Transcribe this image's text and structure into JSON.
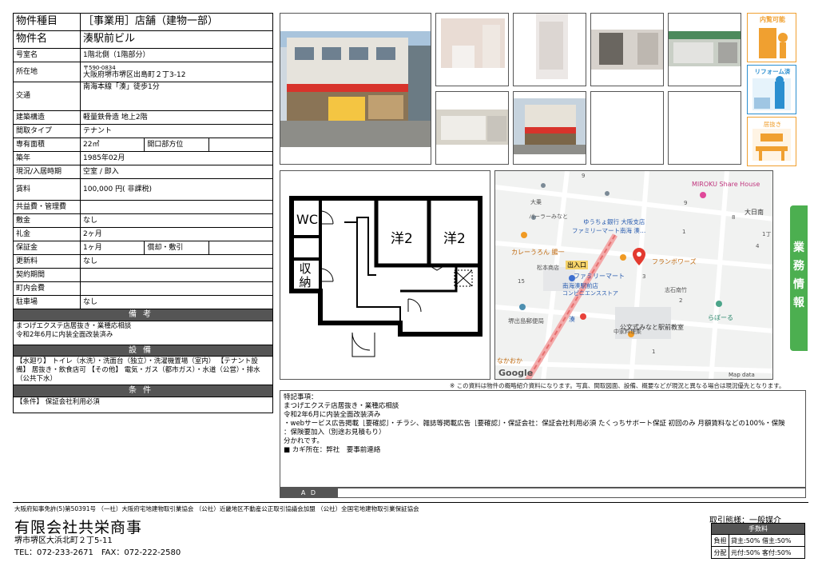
{
  "property": {
    "rows": [
      {
        "key": "物件種目",
        "value": "［事業用］店舗（建物一部）"
      },
      {
        "key": "物件名",
        "value": "湊駅前ビル"
      },
      {
        "key": "号室名",
        "value": "1階北側（1階部分）"
      },
      {
        "key": "所在地",
        "postal": "〒590-0834",
        "value": "大阪府堺市堺区出島町２丁3-12"
      },
      {
        "key": "交通",
        "value": "南海本線「湊」徒歩1分"
      },
      {
        "key": "建築構造",
        "value": "軽量鉄骨造 地上2階"
      },
      {
        "key": "間取タイプ",
        "value": "テナント"
      },
      {
        "key": "専有面積",
        "value": "22㎡",
        "key2": "開口部方位",
        "value2": ""
      },
      {
        "key": "築年",
        "value": "1985年02月"
      },
      {
        "key": "現況/入居時期",
        "value": "空室 / 即入"
      },
      {
        "key": "賃料",
        "value": "100,000 円( 非課税)"
      },
      {
        "key": "共益費・管理費",
        "value": ""
      },
      {
        "key": "敷金",
        "value": "なし"
      },
      {
        "key": "礼金",
        "value": "2ヶ月"
      },
      {
        "key": "保証金",
        "value": "1ヶ月",
        "key2": "償却・敷引",
        "value2": ""
      },
      {
        "key": "更新料",
        "value": "なし"
      },
      {
        "key": "契約期間",
        "value": ""
      },
      {
        "key": "町内会費",
        "value": ""
      },
      {
        "key": "駐車場",
        "value": "なし"
      }
    ],
    "bikou_title": "備考",
    "bikou_lines": [
      "まつげエクステ店居抜き・業種応相談",
      "令和2年6月に内装全面改装済み"
    ],
    "setsubi_title": "設備",
    "setsubi_text": "【水廻り】 トイレ（水洗）・洗面台（独立）・洗濯機置場（室内） 【テナント設備】 居抜き・飲食店可 【その他】 電気・ガス（都市ガス）・水道（公営）・排水（公共下水）",
    "jouken_title": "条件",
    "jouken_text": "【条件】 保証会社利用必須"
  },
  "floorplan": {
    "wc": "WC",
    "storage": "収納",
    "room_a": "洋2",
    "room_b": "洋2"
  },
  "map": {
    "labels": {
      "share_house": "MIROKU Share House",
      "onaijimi": "大日南",
      "daikoji": "大乗",
      "bank": "ゆうちょ銀行 大阪支店",
      "famima1": "ファミリーマート南海 湊…",
      "curry": "カレーうろん 腸一",
      "francbois": "フランボワーズ",
      "famima2": "ファミリーマート",
      "famima2b": "南海湊駅前店",
      "famima2c": "コンビニエンスストア",
      "exit": "出入口",
      "bakery": "バーラーみなと",
      "matsumoto": "松本商店",
      "station": "湊",
      "post": "堺出島郵便局",
      "school": "中家料理集",
      "park": "公文式みなと駅前教室",
      "labo": "らぼーる",
      "nakaoka": "なかおか",
      "shioura": "志石南竹",
      "google": "Google",
      "mapdata": "Map data ©2022"
    },
    "numbers": [
      "9",
      "9",
      "8",
      "1",
      "4",
      "1丁",
      "3",
      "2",
      "15",
      "1"
    ]
  },
  "disclaimer": "※ この資料は物件の概略紹介資料になります。写真、間取図面、設備、概要などが現況と異なる場合は現況優先となります。",
  "side_icons": [
    "内覧可能",
    "リフォーム済",
    "居抜き"
  ],
  "side_tab": [
    "業",
    "務",
    "情",
    "報"
  ],
  "remarks": {
    "lines": [
      "特記事項：",
      "まつげエクステ店居抜き・業種応相談",
      "令和2年6月に内装全面改装済み",
      "・webサービス広告掲載［要確認］・チラシ、雑誌等掲載広告［要確認］・保証会社：保証会社利用必須 たくっちサポート保証 初回のみ 月額賃料などの100%・保険",
      "：保険要加入（別途お見積もり）",
      "分かれです。",
      "■ カギ所在：弊社　要事前連絡"
    ],
    "ad_label": "A D"
  },
  "footer": {
    "association": "大阪府知事免許(5)第50391号 （一社）大阪府宅地建物取引業協会 （公社）近畿地区不動産公正取引協議会加盟 （公社）全国宅地建物取引業保証協会",
    "company": "有限会社共栄商事",
    "address": "堺市堺区大浜北町２丁5-11",
    "tel": "TEL：072-233-2671　FAX：072-222-2580"
  },
  "transaction": {
    "label": "取引態様：一般媒介",
    "fee_header": "手数料",
    "rows": [
      {
        "key": "負担",
        "value": "貸主:50% 借主:50%"
      },
      {
        "key": "分配",
        "value": "元付:50% 客付:50%"
      }
    ]
  }
}
